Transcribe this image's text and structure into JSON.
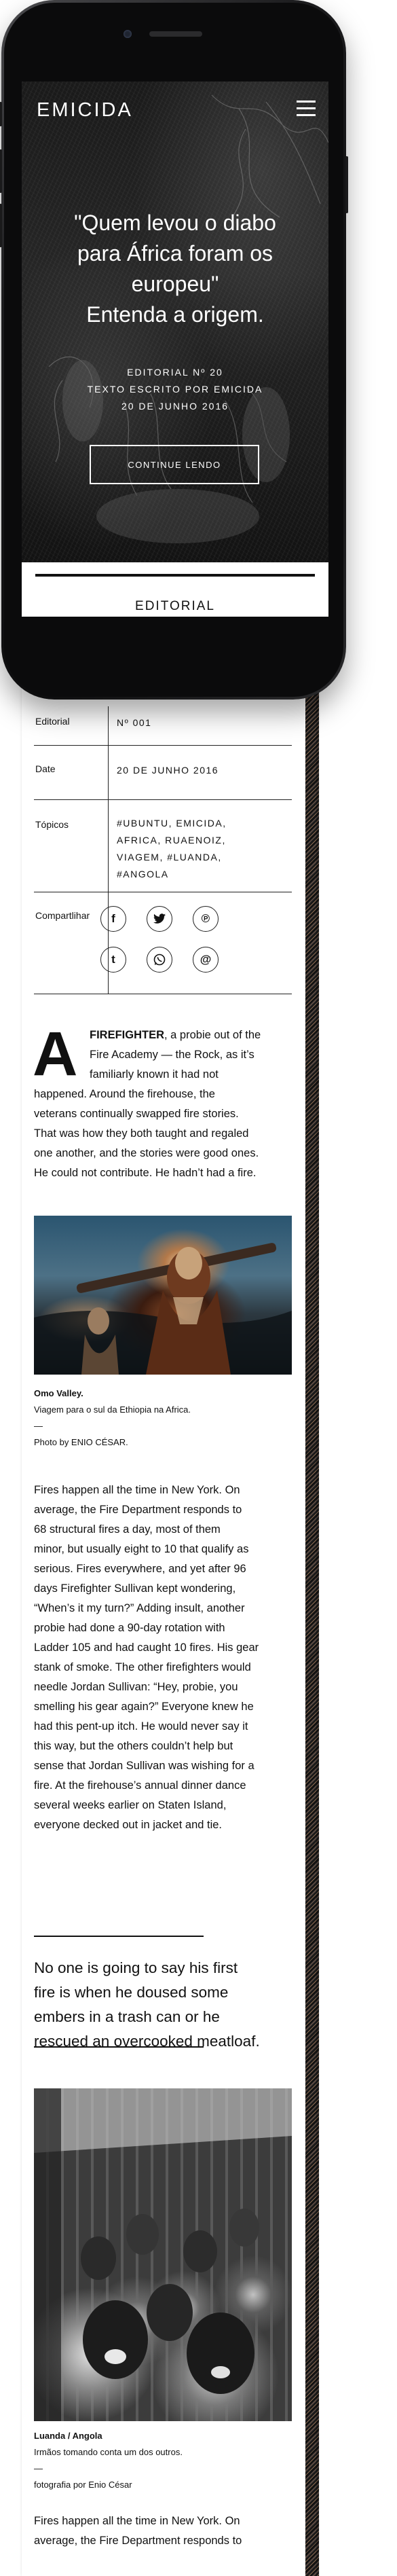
{
  "header": {
    "logo": "EMICIDA",
    "menu_icon": "hamburger-menu-icon"
  },
  "hero": {
    "title_line1": "\"Quem levou o diabo",
    "title_line2": "para África foram os",
    "title_line3": "europeu\"",
    "title_line4": "Entenda a origem.",
    "meta_line1": "EDITORIAL Nº 20",
    "meta_line2": "TEXTO ESCRITO POR EMICIDA",
    "meta_line3": "20 DE JUNHO 2016",
    "button": "CONTINUE LENDO",
    "section_label": "EDITORIAL"
  },
  "meta": {
    "editorial_label": "Editorial",
    "editorial_value": "Nº 001",
    "date_label": "Date",
    "date_value": "20 DE JUNHO 2016",
    "topics_label": "Tópicos",
    "topics_line1": "#UBUNTU, EMICIDA,",
    "topics_line2": "AFRICA, RUAENOIZ,",
    "topics_line3": "VIAGEM, #LUANDA,",
    "topics_line4": "#ANGOLA",
    "share_label": "Compartlihar",
    "share_icons": [
      "facebook-icon",
      "twitter-icon",
      "pinterest-icon",
      "tumblr-icon",
      "whatsapp-icon",
      "email-icon"
    ]
  },
  "article": {
    "drop_cap": "A",
    "p1_lead": "FIREFIGHTER",
    "p1_l1": ", a probie out of the",
    "p1_l2": "Fire Academy — the Rock, as it’s",
    "p1_l3": "familiarly known it had not",
    "p1_l4": "happened. Around the firehouse, the",
    "p1_l5": "veterans continually swapped fire stories.",
    "p1_l6": "That was how they both taught and regaled",
    "p1_l7": "one another, and the stories were good ones.",
    "p1_l8": "He could not contribute. He hadn’t had a fire.",
    "cap1_title": "Omo Valley.",
    "cap1_sub": "Viagem para o sul da Ethiopia na Africa.",
    "cap1_dash": "—",
    "cap1_credit": "Photo by ENIO CÉSAR.",
    "p2": [
      "Fires happen all the time in New York. On",
      "average, the Fire Department responds to",
      "68 structural fires a day, most of them",
      "minor, but usually eight to 10 that qualify as",
      "serious. Fires everywhere, and yet after 96",
      "days Firefighter Sullivan kept wondering,",
      "“When’s it my turn?” Adding insult, another",
      "probie had done a 90-day rotation with",
      "Ladder 105 and had caught 10 fires. His gear",
      "stank of smoke. The other firefighters would",
      "needle Jordan Sullivan: “Hey, probie, you",
      "smelling his gear again?” Everyone knew he",
      "had this pent-up itch. He would never say it",
      "this way, but the others couldn’t help but",
      "sense that Jordan Sullivan was wishing for a",
      "fire. At the firehouse’s annual dinner dance",
      "several weeks earlier on Staten Island,",
      "everyone decked out in jacket and tie."
    ],
    "quote_l1": "No one is going to say his first",
    "quote_l2": "fire is when he doused some",
    "quote_l3": "embers in a trash can or he",
    "quote_l4": "rescued an overcooked meatloaf.",
    "cap2_title": "Luanda / Angola",
    "cap2_sub": "Irmãos tomando conta um dos outros.",
    "cap2_dash": "—",
    "cap2_credit": "fotografia por Enio César",
    "p3_l1": "Fires happen all the time in New York. On",
    "p3_l2": "average, the Fire Department responds to"
  }
}
